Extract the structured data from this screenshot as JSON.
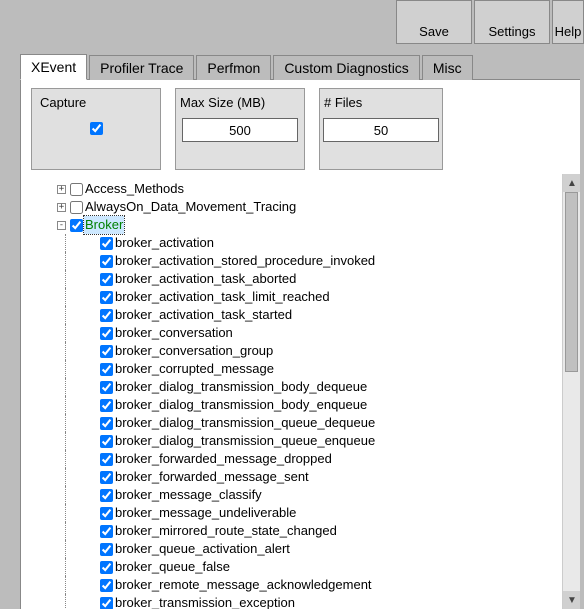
{
  "toolbar": {
    "save": "Save",
    "settings": "Settings",
    "help": "Help"
  },
  "tabs": {
    "xevent": "XEvent",
    "profiler": "Profiler Trace",
    "perfmon": "Perfmon",
    "custom": "Custom Diagnostics",
    "misc": "Misc"
  },
  "config": {
    "capture_label": "Capture",
    "maxsize_label": "Max Size (MB)",
    "files_label": "# Files",
    "maxsize_value": "500",
    "files_value": "50"
  },
  "tree": {
    "access_methods": "Access_Methods",
    "alwayson": "AlwaysOn_Data_Movement_Tracing",
    "broker": "Broker",
    "children": [
      "broker_activation",
      "broker_activation_stored_procedure_invoked",
      "broker_activation_task_aborted",
      "broker_activation_task_limit_reached",
      "broker_activation_task_started",
      "broker_conversation",
      "broker_conversation_group",
      "broker_corrupted_message",
      "broker_dialog_transmission_body_dequeue",
      "broker_dialog_transmission_body_enqueue",
      "broker_dialog_transmission_queue_dequeue",
      "broker_dialog_transmission_queue_enqueue",
      "broker_forwarded_message_dropped",
      "broker_forwarded_message_sent",
      "broker_message_classify",
      "broker_message_undeliverable",
      "broker_mirrored_route_state_changed",
      "broker_queue_activation_alert",
      "broker_queue_false",
      "broker_remote_message_acknowledgement",
      "broker_transmission_exception"
    ]
  }
}
